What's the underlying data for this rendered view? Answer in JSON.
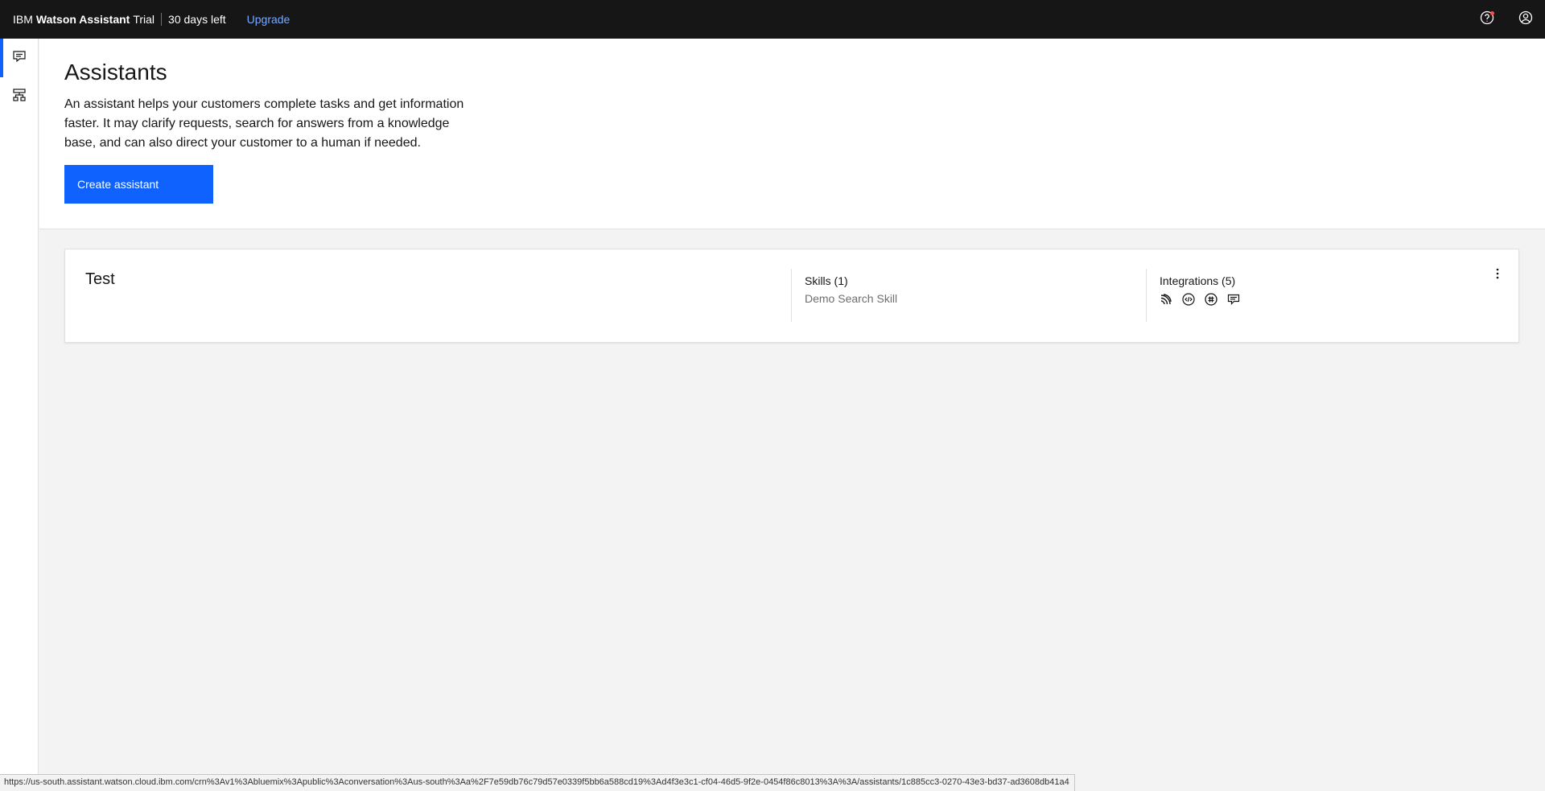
{
  "topbar": {
    "brand_ibm": "IBM",
    "brand_product": "Watson Assistant",
    "brand_plan": "Trial",
    "days_left": "30 days left",
    "upgrade_label": "Upgrade",
    "icons": [
      "help-icon",
      "user-avatar-icon"
    ],
    "notification_color": "#fa4d56"
  },
  "sidenav": {
    "items": [
      {
        "icon": "chat-icon",
        "active": true
      },
      {
        "icon": "skills-icon",
        "active": false
      }
    ]
  },
  "header": {
    "title": "Assistants",
    "description": "An assistant helps your customers complete tasks and get information faster. It may clarify requests, search for answers from a knowledge base, and can also direct your customer to a human if needed.",
    "create_button": "Create assistant"
  },
  "assistants": [
    {
      "name": "Test",
      "skills_title": "Skills (1)",
      "skills_list": "Demo Search Skill",
      "integrations_title": "Integrations (5)",
      "integration_icons": [
        "voice-icon",
        "web-chat-icon",
        "slack-icon",
        "preview-chat-icon"
      ]
    }
  ],
  "statusbar": {
    "url": "https://us-south.assistant.watson.cloud.ibm.com/crn%3Av1%3Abluemix%3Apublic%3Aconversation%3Aus-south%3Aa%2F7e59db76c79d57e0339f5bb6a588cd19%3Ad4f3e3c1-cf04-46d5-9f2e-0454f86c8013%3A%3A/assistants/1c885cc3-0270-43e3-bd37-ad3608db41a4"
  },
  "colors": {
    "primary": "#0f62fe",
    "topbar": "#161616",
    "link": "#78a9ff"
  }
}
